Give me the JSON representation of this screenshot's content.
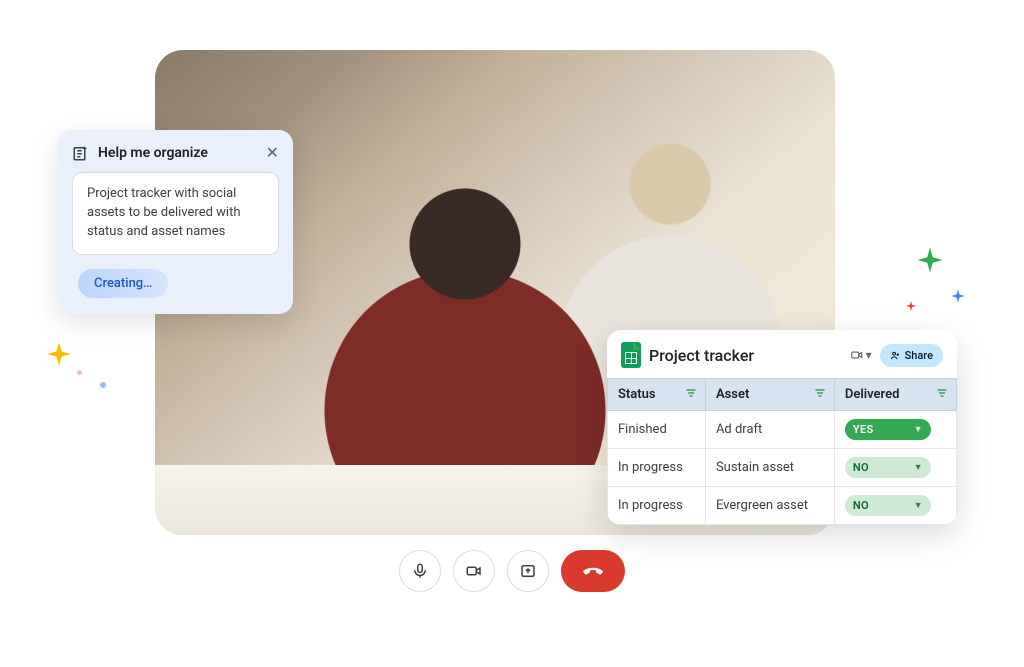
{
  "help_card": {
    "title": "Help me organize",
    "prompt": "Project tracker with social assets to be delivered with status and asset names",
    "status": "Creating…"
  },
  "sheet": {
    "title": "Project tracker",
    "share_label": "Share",
    "columns": [
      "Status",
      "Asset",
      "Delivered"
    ],
    "rows": [
      {
        "status": "Finished",
        "asset": "Ad draft",
        "delivered": "YES"
      },
      {
        "status": "In progress",
        "asset": "Sustain asset",
        "delivered": "NO"
      },
      {
        "status": "In progress",
        "asset": "Evergreen asset",
        "delivered": "NO"
      }
    ]
  },
  "colors": {
    "sparkle_green": "#34a853",
    "sparkle_blue": "#4285f4",
    "sparkle_red": "#ea4335",
    "sparkle_yellow": "#fbbc04",
    "dot_blue": "#9bb7ff",
    "dot_pink": "#f8b6c3"
  }
}
